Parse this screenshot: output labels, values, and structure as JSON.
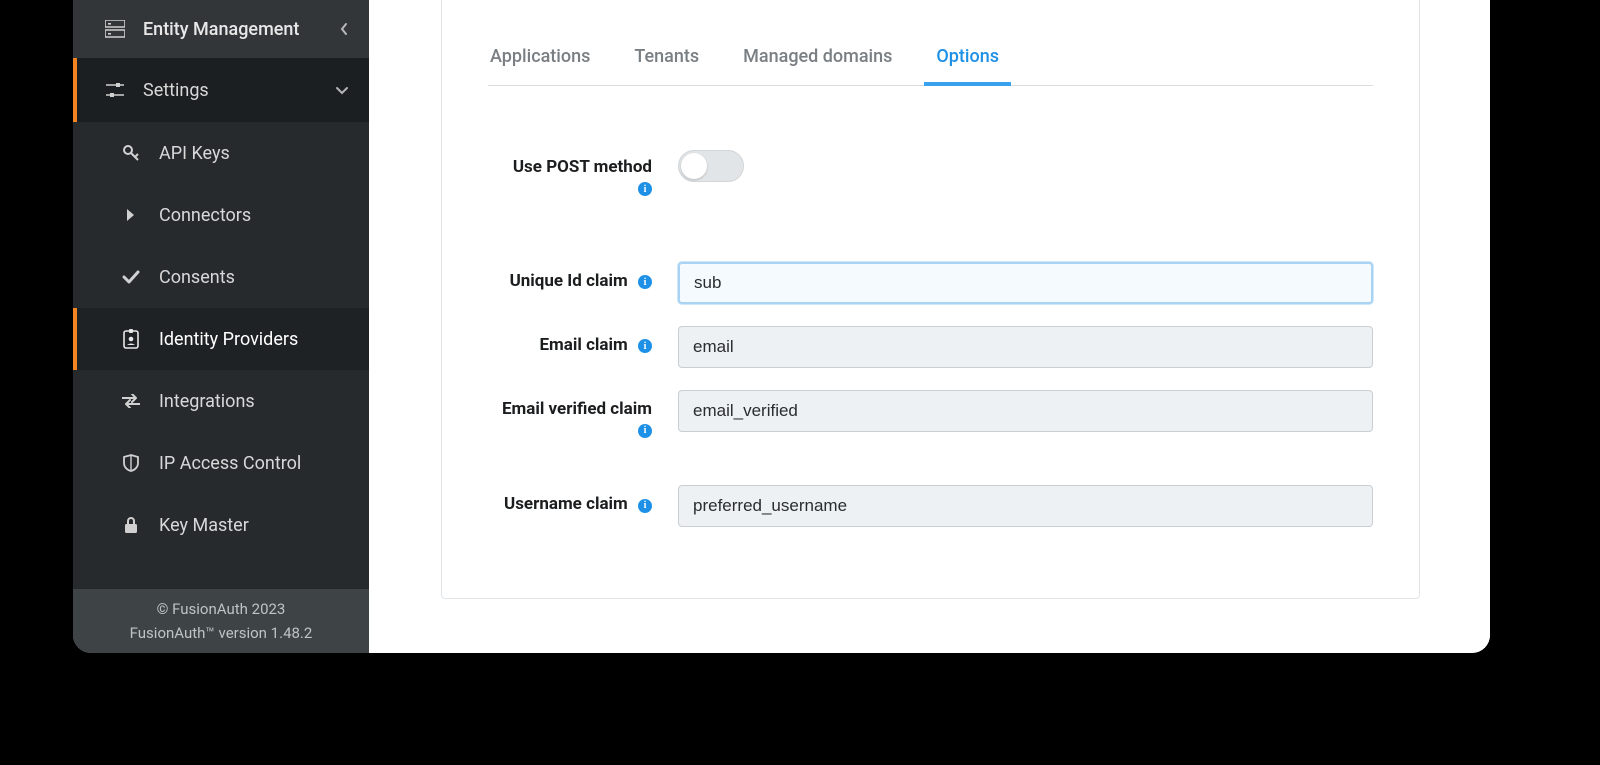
{
  "sidebar": {
    "top": {
      "label": "Entity Management"
    },
    "section": {
      "label": "Settings"
    },
    "items": [
      {
        "label": "API Keys",
        "icon": "key"
      },
      {
        "label": "Connectors",
        "icon": "chevron-right-bold"
      },
      {
        "label": "Consents",
        "icon": "check"
      },
      {
        "label": "Identity Providers",
        "icon": "id-badge",
        "active": true
      },
      {
        "label": "Integrations",
        "icon": "exchange"
      },
      {
        "label": "IP Access Control",
        "icon": "shield"
      },
      {
        "label": "Key Master",
        "icon": "lock"
      }
    ],
    "footer_line1": "© FusionAuth 2023",
    "footer_line2": "FusionAuth™ version 1.48.2"
  },
  "tabs": [
    {
      "label": "Applications",
      "active": false
    },
    {
      "label": "Tenants",
      "active": false
    },
    {
      "label": "Managed domains",
      "active": false
    },
    {
      "label": "Options",
      "active": true
    }
  ],
  "form": {
    "use_post_label": "Use POST method",
    "use_post_value": false,
    "unique_id_label": "Unique Id claim",
    "unique_id_value": "sub",
    "email_label": "Email claim",
    "email_value": "email",
    "email_verified_label": "Email verified claim",
    "email_verified_value": "email_verified",
    "username_label": "Username claim",
    "username_value": "preferred_username"
  }
}
